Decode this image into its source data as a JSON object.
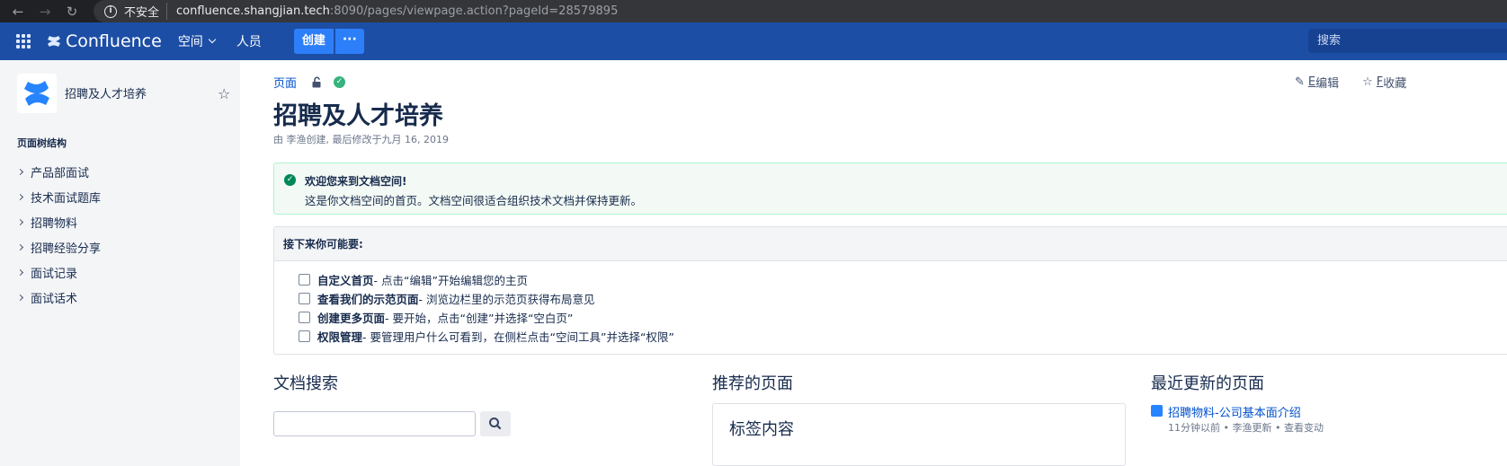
{
  "browser": {
    "insecure_label": "不安全",
    "url_host": "confluence.shangjian.tech",
    "url_path": ":8090/pages/viewpage.action?pageId=28579895"
  },
  "header": {
    "brand": "Confluence",
    "spaces": "空间",
    "people": "人员",
    "create": "创建",
    "more": "···",
    "search_placeholder": "搜索"
  },
  "sidebar": {
    "space_name": "招聘及人才培养",
    "tree_title": "页面树结构",
    "items": [
      {
        "label": "产品部面试"
      },
      {
        "label": "技术面试题库"
      },
      {
        "label": "招聘物料"
      },
      {
        "label": "招聘经验分享"
      },
      {
        "label": "面试记录"
      },
      {
        "label": "面试话术"
      }
    ]
  },
  "page": {
    "breadcrumb": "页面",
    "title": "招聘及人才培养",
    "byline": "由 李渔创建, 最后修改于九月 16, 2019",
    "edit_key": "E",
    "edit_label": "编辑",
    "save_key": "F",
    "save_label": "收藏"
  },
  "welcome": {
    "title": "欢迎您来到文档空间!",
    "body": "这是你文档空间的首页。文档空间很适合组织技术文档并保持更新。"
  },
  "next_steps": {
    "heading": "接下来你可能要:",
    "tasks": [
      {
        "bold": "自定义首页",
        "rest": " - 点击“编辑”开始编辑您的主页"
      },
      {
        "bold": "查看我们的示范页面",
        "rest": " - 浏览边栏里的示范页获得布局意见"
      },
      {
        "bold": "创建更多页面",
        "rest": " - 要开始，点击“创建”并选择“空白页”"
      },
      {
        "bold": "权限管理",
        "rest": " - 要管理用户什么可看到，在侧栏点击“空间工具”并选择“权限”"
      }
    ]
  },
  "sections": {
    "doc_search": "文档搜索",
    "recommended": "推荐的页面",
    "recent": "最近更新的页面",
    "tag_content": "标签内容"
  },
  "recent_item": {
    "title": "招聘物料-公司基本面介绍",
    "meta": "11分钟以前 • 李渔更新 • 查看变动"
  }
}
